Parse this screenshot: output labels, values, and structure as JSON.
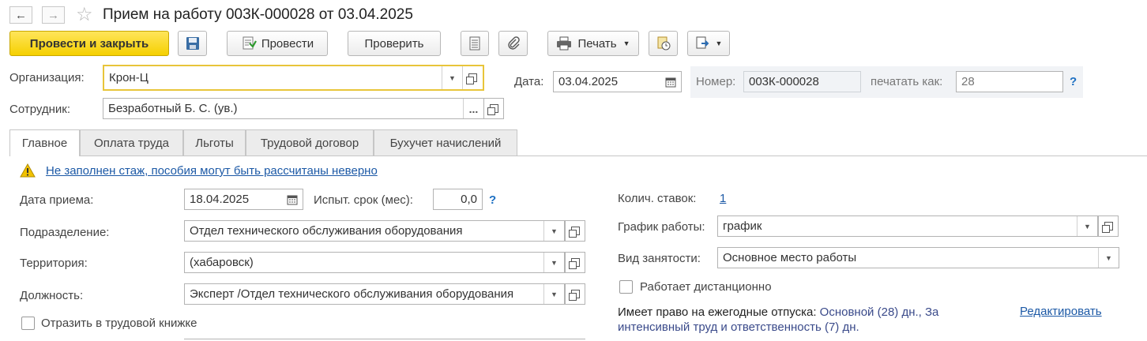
{
  "window": {
    "title": "Прием на работу 003К-000028 от 03.04.2025",
    "back_icon": "←",
    "forward_icon": "→",
    "star_icon": "☆"
  },
  "toolbar": {
    "post_close_label": "Провести и закрыть",
    "post_label": "Провести",
    "check_label": "Проверить",
    "print_label": "Печать"
  },
  "header": {
    "org_label": "Организация:",
    "org_value": "Крон-Ц",
    "date_label": "Дата:",
    "date_value": "03.04.2025",
    "number_label": "Номер:",
    "number_value": "003К-000028",
    "print_as_label": "печатать как:",
    "print_as_placeholder": "28",
    "help": "?",
    "employee_label": "Сотрудник:",
    "employee_value": "Безработный Б. С. (ув.)",
    "dots": "..."
  },
  "tabs": [
    {
      "label": "Главное"
    },
    {
      "label": "Оплата труда"
    },
    {
      "label": "Льготы"
    },
    {
      "label": "Трудовой договор"
    },
    {
      "label": "Бухучет начислений"
    }
  ],
  "main": {
    "warning_text": "Не заполнен стаж, пособия могут быть рассчитаны неверно",
    "hire_date_label": "Дата приема:",
    "hire_date_value": "18.04.2025",
    "probation_label": "Испыт. срок (мес):",
    "probation_value": "0,0",
    "help": "?",
    "department_label": "Подразделение:",
    "department_value": "Отдел технического обслуживания оборудования",
    "territory_label": "Территория:",
    "territory_value": "(хабаровск)",
    "position_label": "Должность:",
    "position_value": "Эксперт /Отдел технического обслуживания оборудования",
    "reflect_label": "Отразить в трудовой книжке",
    "rates_label": "Колич. ставок:",
    "rates_value": "1",
    "schedule_label": "График работы:",
    "schedule_value": "график",
    "employment_label": "Вид занятости:",
    "employment_value": "Основное место работы",
    "remote_label": "Работает дистанционно",
    "vacation_label": "Имеет право на ежегодные отпуска:",
    "vacation_value_line1": "Основной (28) дн., За",
    "vacation_value_line2": "интенсивный труд и ответственность (7) дн.",
    "edit_link": "Редактировать"
  },
  "colors": {
    "primary_button": "#f5d000",
    "link": "#1c59a6",
    "active_field_border": "#e8c53a",
    "warning": "#f2c200"
  }
}
